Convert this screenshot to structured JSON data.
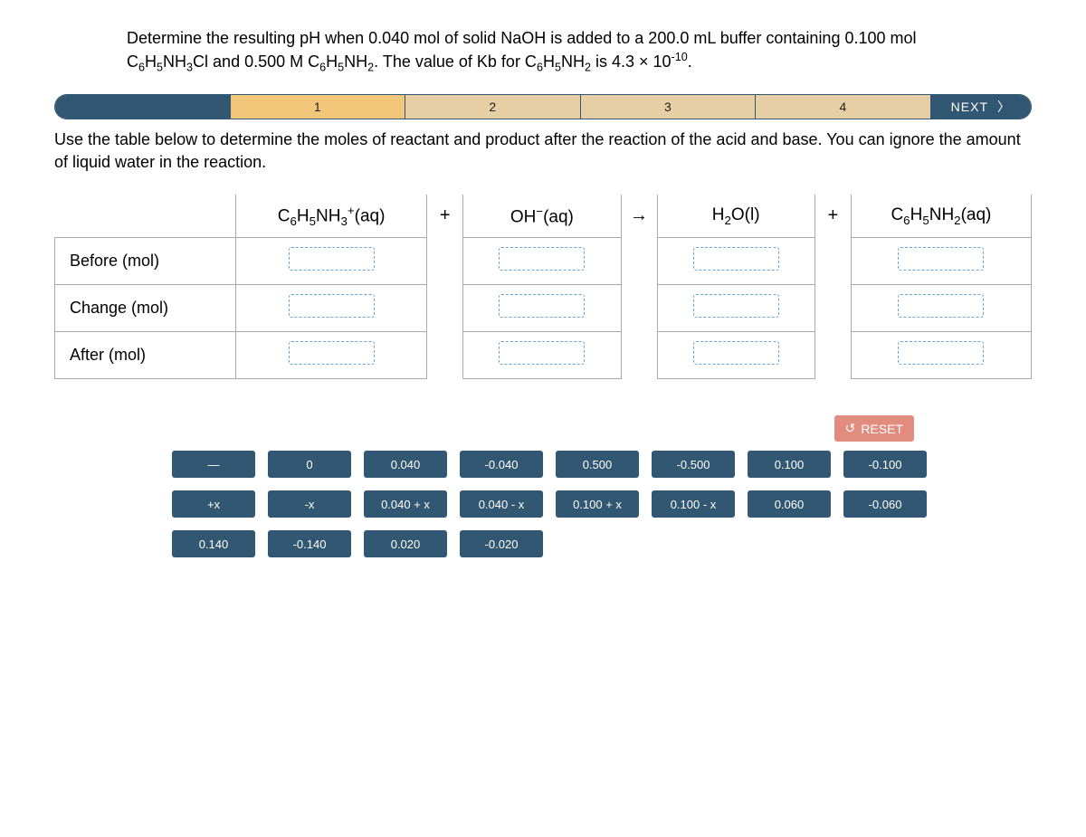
{
  "question_html": "Determine the resulting pH when 0.040 mol of solid NaOH is added to a 200.0 mL buffer containing 0.100 mol C<sub>6</sub>H<sub>5</sub>NH<sub>3</sub>Cl and 0.500 M C<sub>6</sub>H<sub>5</sub>NH<sub>2</sub>. The value of Kb for C<sub>6</sub>H<sub>5</sub>NH<sub>2</sub> is 4.3 × 10<sup>-10</sup>.",
  "progress": {
    "steps": [
      "1",
      "2",
      "3",
      "4"
    ],
    "active_index": 1,
    "next_label": "NEXT"
  },
  "instruction": "Use the table below to determine the moles of reactant and product after the reaction of the acid and base. You can ignore the amount of liquid water in the reaction.",
  "reaction": {
    "species1_html": "C<sub>6</sub>H<sub>5</sub>NH<sub>3</sub><sup>+</sup>(aq)",
    "plus1": "+",
    "species2_html": "OH<sup>−</sup>(aq)",
    "arrow": "→",
    "species3_html": "H<sub>2</sub>O(l)",
    "plus2": "+",
    "species4_html": "C<sub>6</sub>H<sub>5</sub>NH<sub>2</sub>(aq)"
  },
  "row_labels": [
    "Before (mol)",
    "Change (mol)",
    "After (mol)"
  ],
  "reset_label": "RESET",
  "tiles": {
    "row1": [
      "—",
      "0",
      "0.040",
      "-0.040",
      "0.500",
      "-0.500",
      "0.100",
      "-0.100"
    ],
    "row2": [
      "+x",
      "-x",
      "0.040 + x",
      "0.040 - x",
      "0.100 + x",
      "0.100 - x",
      "0.060",
      "-0.060"
    ],
    "row3": [
      "0.140",
      "-0.140",
      "0.020",
      "-0.020"
    ]
  }
}
